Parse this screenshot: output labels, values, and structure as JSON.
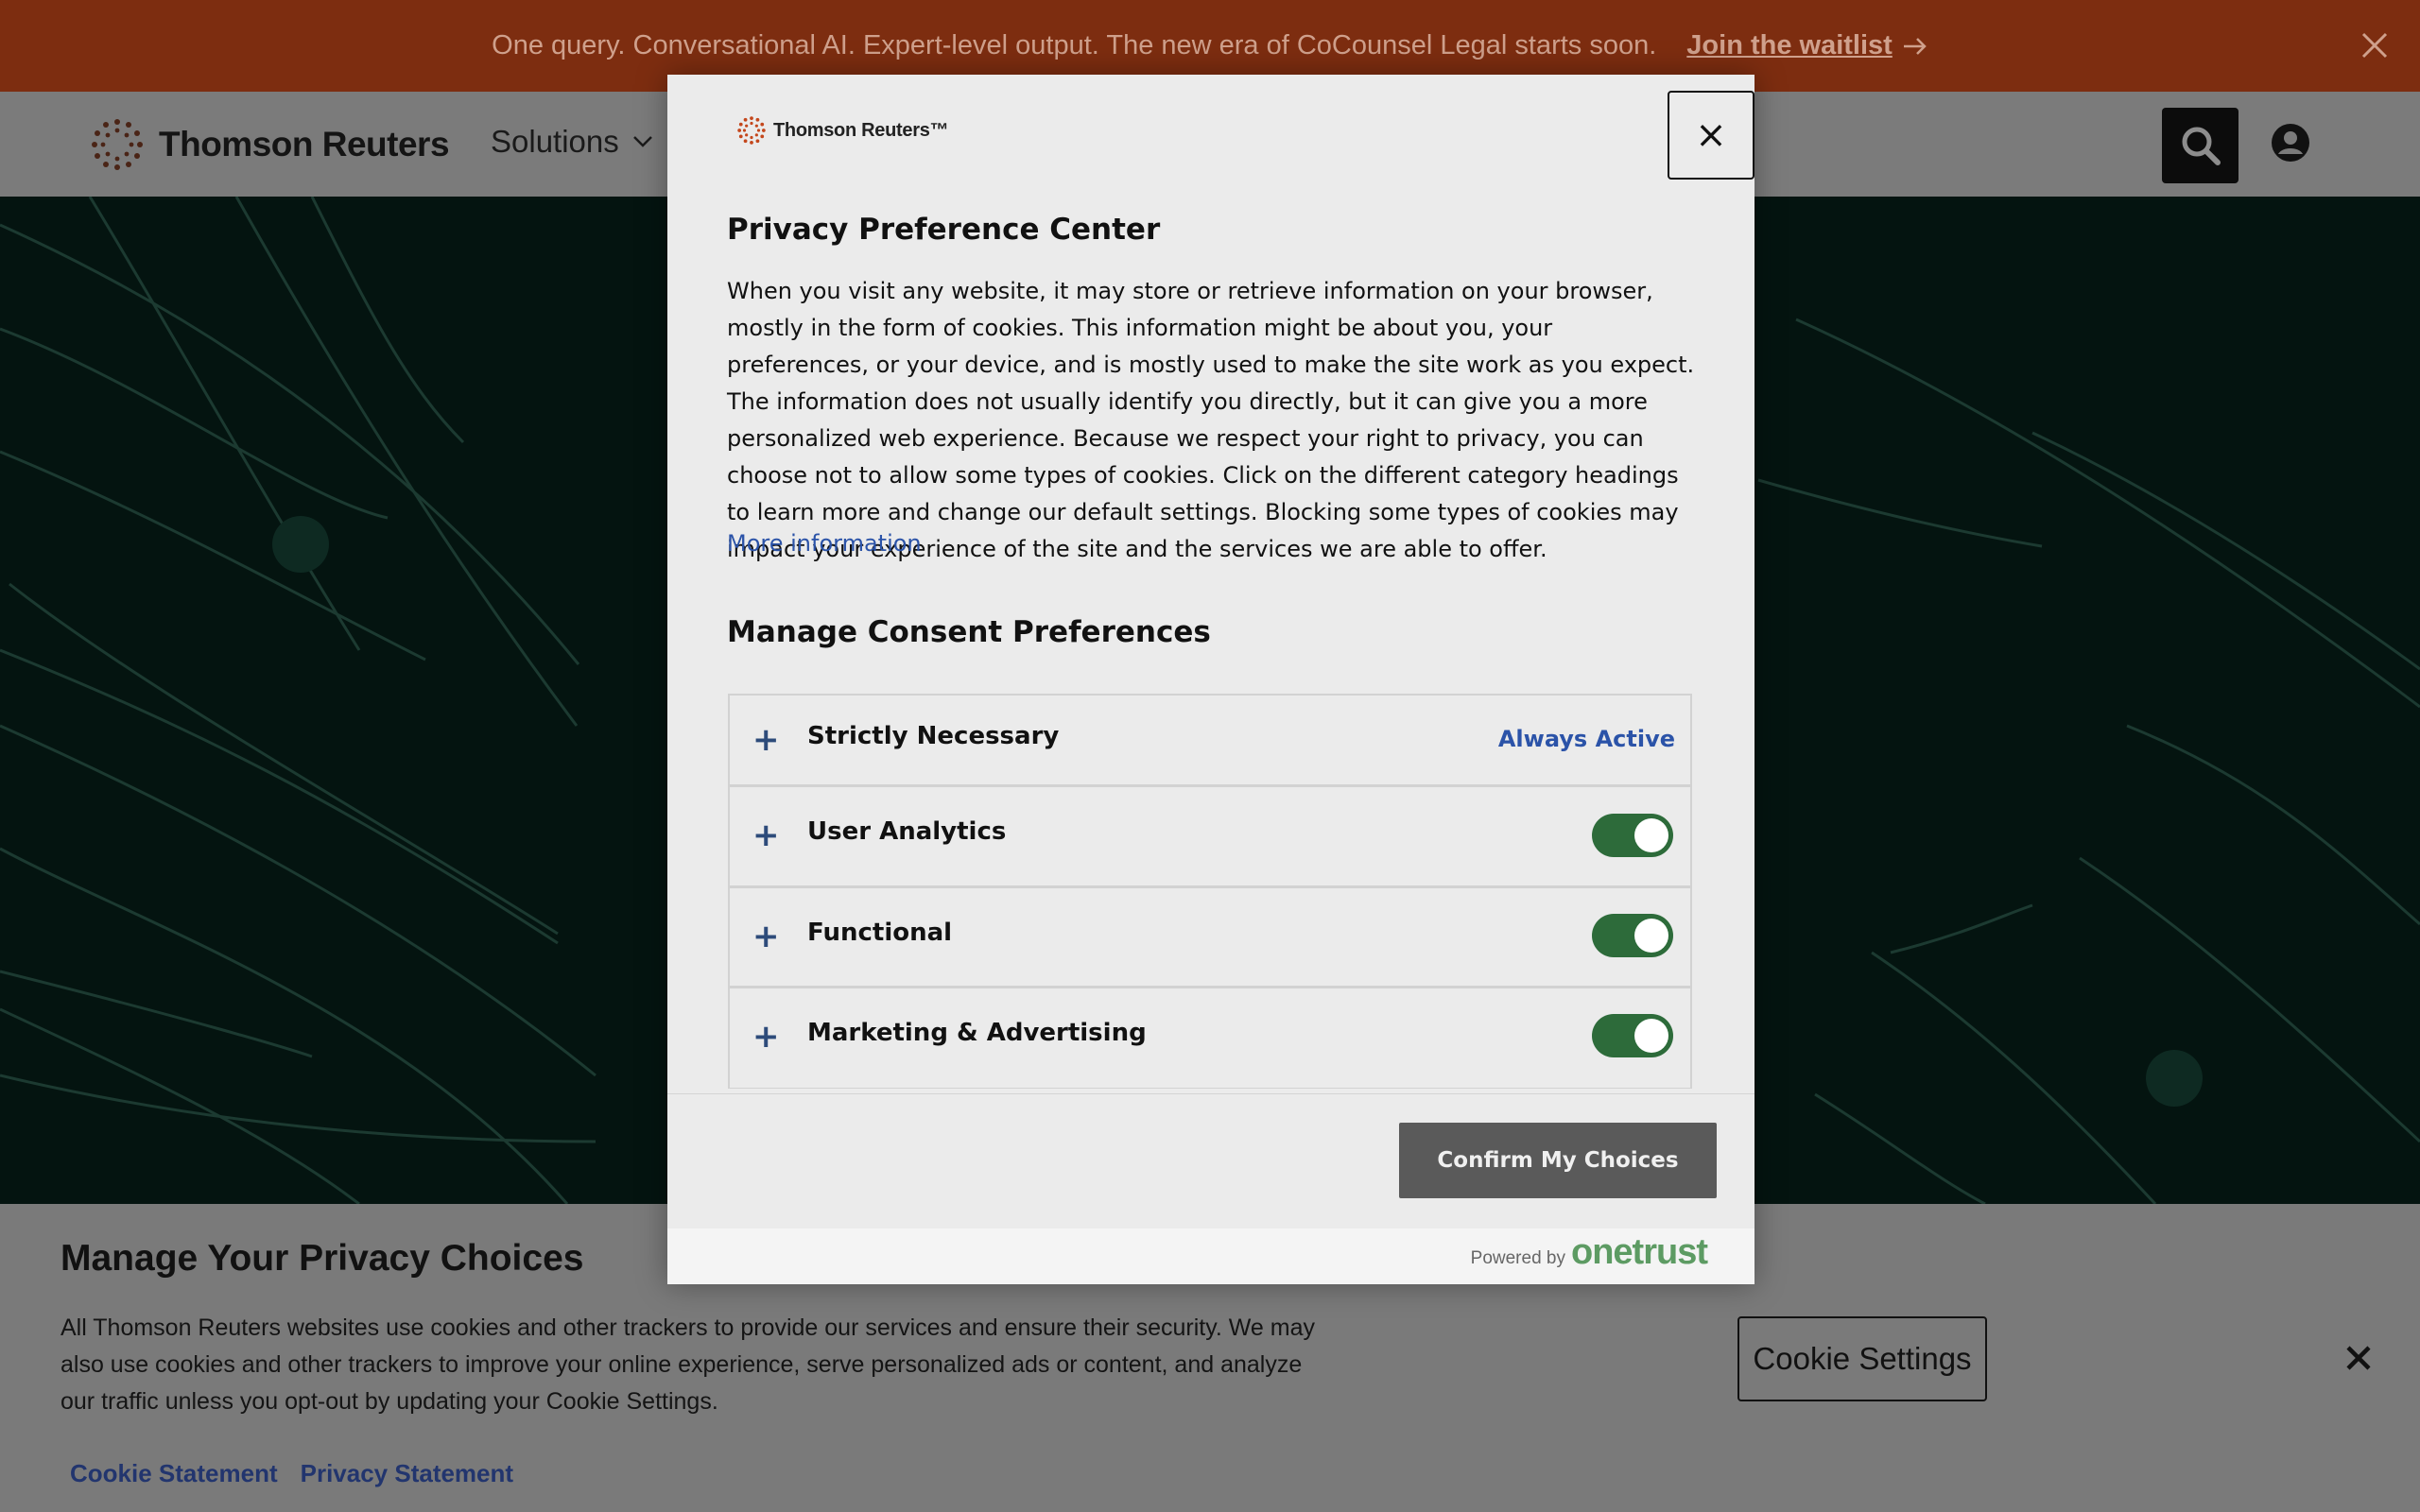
{
  "promo": {
    "text": "One query. Conversational AI. Expert-level output. The new era of CoCounsel Legal starts soon.",
    "link_label": "Join the waitlist"
  },
  "header": {
    "brand_name": "Thomson Reuters",
    "nav_solutions": "Solutions",
    "search_icon": "search-icon",
    "account_icon": "account-icon"
  },
  "cookie_banner": {
    "title": "Manage Your Privacy Choices",
    "body": "All Thomson Reuters websites use cookies and other trackers to provide our services and ensure their security. We may also use cookies and other trackers to improve your online experience, serve personalized ads or content, and analyze our traffic unless you opt-out by updating your Cookie Settings.",
    "links": [
      "Cookie Statement",
      "Privacy Statement"
    ],
    "settings_label": "Cookie Settings"
  },
  "modal": {
    "logo_text": "Thomson Reuters™",
    "close_symbol": "×",
    "title": "Privacy Preference Center",
    "description": "When you visit any website, it may store or retrieve information on your browser, mostly in the form of cookies. This information might be about you, your preferences, or your device, and is mostly used to make the site work as you expect. The information does not usually identify you directly, but it can give you a more personalized web experience. Because we respect your right to privacy, you can choose not to allow some types of cookies. Click on the different category headings to learn more and change our default settings. Blocking some types of cookies may impact your experience of the site and the services we are able to offer.",
    "more_info": "More information",
    "manage_title": "Manage Consent Preferences",
    "categories": [
      {
        "label": "Strictly Necessary",
        "status": "Always Active"
      },
      {
        "label": "User Analytics",
        "enabled": true
      },
      {
        "label": "Functional",
        "enabled": true
      },
      {
        "label": "Marketing & Advertising",
        "enabled": true
      }
    ],
    "confirm_label": "Confirm My Choices",
    "powered_by": "Powered by",
    "powered_brand": "onetrust"
  },
  "colors": {
    "promo_bg": "#7d2d10",
    "toggle_on": "#2d6b3a",
    "link_blue": "#2b53a8",
    "onetrust_green": "#5d9b63"
  }
}
